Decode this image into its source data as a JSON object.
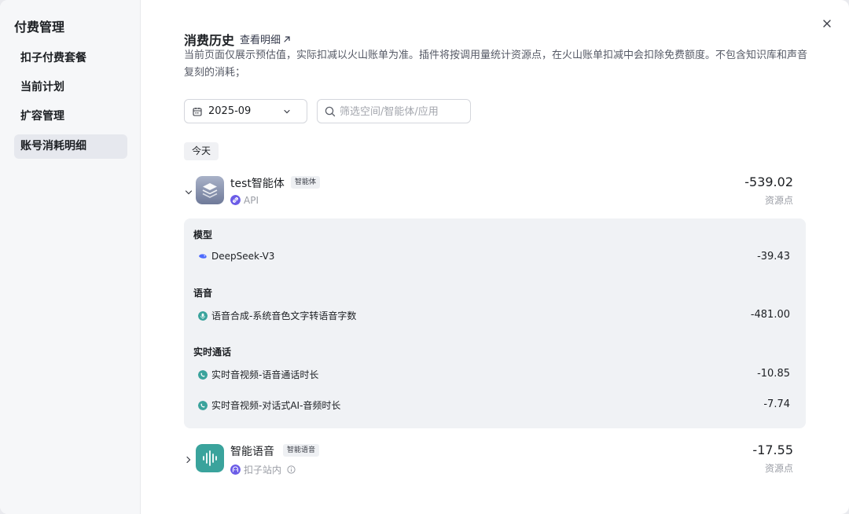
{
  "sidebar": {
    "title": "付费管理",
    "items": [
      {
        "label": "扣子付费套餐"
      },
      {
        "label": "当前计划"
      },
      {
        "label": "扩容管理"
      },
      {
        "label": "账号消耗明细"
      }
    ]
  },
  "header": {
    "title": "消费历史",
    "detail_link": "查看明细",
    "description": "当前页面仅展示预估值，实际扣减以火山账单为准。插件将按调用量统计资源点，在火山账单扣减中会扣除免费额度。不包含知识库和声音复刻的消耗；"
  },
  "filters": {
    "date_value": "2025-09",
    "search_placeholder": "筛选空间/智能体/应用"
  },
  "day_label": "今天",
  "items": [
    {
      "name": "test智能体",
      "tag": "智能体",
      "source": "API",
      "amount": "-539.02",
      "unit": "资源点",
      "expanded": true
    },
    {
      "name": "智能语音",
      "tag": "智能语音",
      "source": "扣子站内",
      "amount": "-17.55",
      "unit": "资源点",
      "expanded": false
    }
  ],
  "details": {
    "sections": [
      {
        "title": "模型",
        "rows": [
          {
            "label": "DeepSeek-V3",
            "amount": "-39.43"
          }
        ]
      },
      {
        "title": "语音",
        "rows": [
          {
            "label": "语音合成-系统音色文字转语音字数",
            "amount": "-481.00"
          }
        ]
      },
      {
        "title": "实时通话",
        "rows": [
          {
            "label": "实时音视频-语音通话时长",
            "amount": "-10.85"
          },
          {
            "label": "实时音视频-对话式AI-音频时长",
            "amount": "-7.74"
          }
        ]
      }
    ]
  },
  "colors": {
    "accent": "#4d53e8",
    "teal": "#3aa39c",
    "panel_bg": "#f0f2f5"
  }
}
